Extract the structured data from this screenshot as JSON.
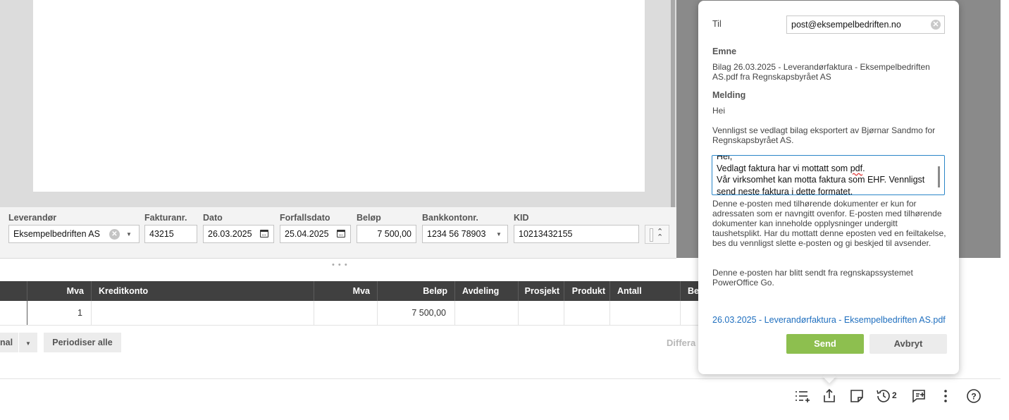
{
  "fields": {
    "leverandor": {
      "label": "Leverandør",
      "value": "Eksempelbedriften AS"
    },
    "fakturanr": {
      "label": "Fakturanr.",
      "value": "43215"
    },
    "dato": {
      "label": "Dato",
      "value": "26.03.2025"
    },
    "forfallsdato": {
      "label": "Forfallsdato",
      "value": "25.04.2025"
    },
    "belop": {
      "label": "Beløp",
      "value": "7 500,00"
    },
    "bankkontonr": {
      "label": "Bankkontonr.",
      "value": "1234 56 78903"
    },
    "kid": {
      "label": "KID",
      "value": "10213432155"
    }
  },
  "table": {
    "headers": [
      "Mva",
      "Kreditkonto",
      "Mva",
      "Beløp",
      "Avdeling",
      "Prosjekt",
      "Produkt",
      "Antall",
      "Be"
    ],
    "row": {
      "mva": "1",
      "kreditkonto": "",
      "mva2": "",
      "belop": "7 500,00"
    }
  },
  "actions": {
    "split_label": "nal",
    "periodiser_label": "Periodiser alle",
    "differanse_label": "Differa"
  },
  "toolbar": {
    "history_count": "2"
  },
  "email": {
    "to_label": "Til",
    "to_value": "post@eksempelbedriften.no",
    "subject_label": "Emne",
    "subject": "Bilag 26.03.2025 - Leverandørfaktura - Eksempelbedriften AS.pdf fra Regnskapsbyrået AS",
    "message_label": "Melding",
    "greeting": "Hei",
    "intro": "Vennligst se vedlagt bilag eksportert av Bjørnar Sandmo for Regnskapsbyrået AS.",
    "custom_message": {
      "line1": "Hei,",
      "line2_pre": "Vedlagt faktura har vi mottatt som ",
      "line2_misspelled": "pdf",
      "line2_post": ".",
      "line3": "Vår virksomhet kan motta faktura som EHF. Vennligst send neste faktura i dette formatet."
    },
    "disclaimer": "Denne e-posten med tilhørende dokumenter er kun for adressaten som er navngitt ovenfor. E-posten med tilhørende dokumenter kan inneholde opplysninger undergitt taushetsplikt. Har du mottatt denne eposten ved en feiltakelse, bes du vennligst slette e-posten og gi beskjed til avsender.",
    "footer": "Denne e-posten har blitt sendt fra regnskapssystemet PowerOffice Go.",
    "attachment": "26.03.2025 - Leverandørfaktura - Eksempelbedriften AS.pdf",
    "send_label": "Send",
    "cancel_label": "Avbryt"
  },
  "colors": {
    "send_green": "#8dbf4f",
    "focus_blue": "#2a86c8",
    "link_blue": "#1f6fbf",
    "table_header": "#404040"
  },
  "icons": [
    "list-add-icon",
    "share-icon",
    "note-icon",
    "history-icon",
    "comment-add-icon",
    "more-vertical-icon",
    "help-icon",
    "calendar-icon",
    "clear-icon",
    "chevron-down-icon",
    "chevron-up-icon"
  ]
}
